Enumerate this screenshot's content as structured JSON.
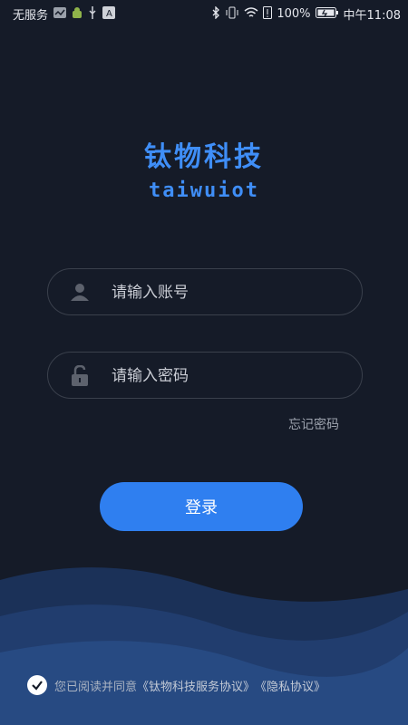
{
  "status_bar": {
    "carrier": "无服务",
    "battery": "100%",
    "time": "中午11:08"
  },
  "brand": {
    "title": "钛物科技",
    "subtitle": "taiwuiot"
  },
  "form": {
    "account_placeholder": "请输入账号",
    "password_placeholder": "请输入密码",
    "forgot_label": "忘记密码",
    "login_label": "登录"
  },
  "agreement": {
    "prefix": "您已阅读并同意",
    "service_link": "《钛物科技服务协议》",
    "privacy_link": "《隐私协议》"
  },
  "colors": {
    "accent": "#2f7ff0",
    "background": "#151b28",
    "wave_dark": "#1c3a66",
    "wave_light": "#25508a"
  },
  "icons": [
    "user-icon",
    "lock-icon",
    "check-icon",
    "wifi-icon",
    "battery-icon",
    "bluetooth-icon"
  ]
}
